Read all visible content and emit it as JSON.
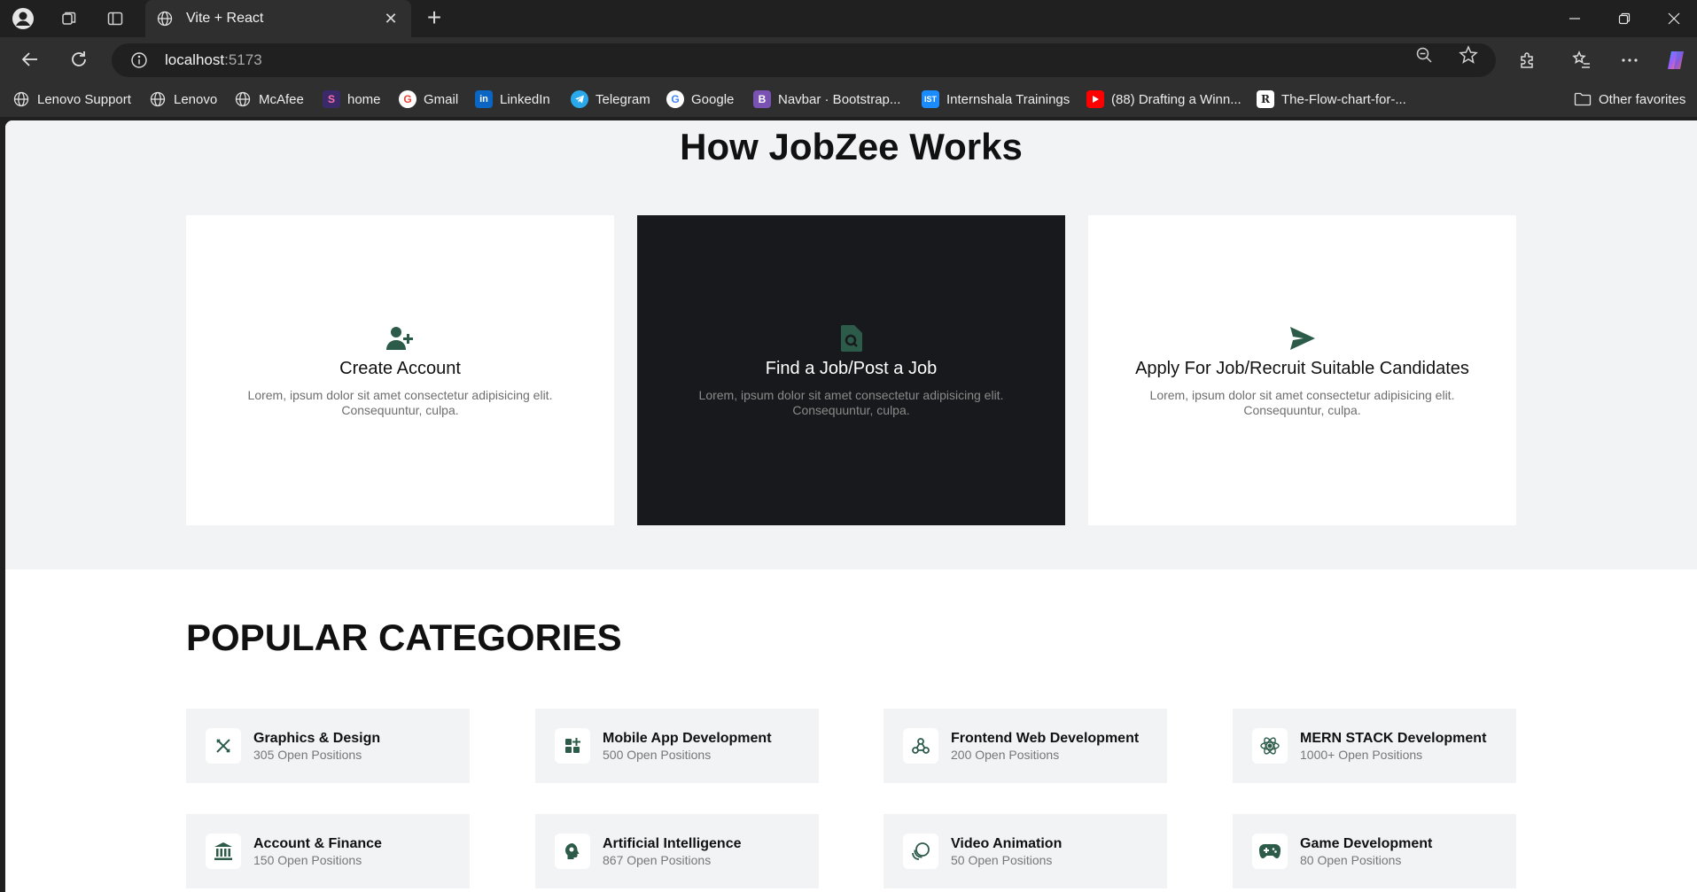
{
  "browser": {
    "tab_title": "Vite + React",
    "url_host": "localhost",
    "url_port": ":5173",
    "bookmarks": [
      {
        "label": "Lenovo Support",
        "icon": "globe-icon"
      },
      {
        "label": "Lenovo",
        "icon": "globe-icon"
      },
      {
        "label": "McAfee",
        "icon": "globe-icon"
      },
      {
        "label": "home",
        "icon": "s-logo-icon"
      },
      {
        "label": "Gmail",
        "icon": "google-icon"
      },
      {
        "label": "LinkedIn",
        "icon": "linkedin-icon"
      },
      {
        "label": "Telegram",
        "icon": "telegram-icon"
      },
      {
        "label": "Google",
        "icon": "google-icon"
      },
      {
        "label": "Navbar · Bootstrap...",
        "icon": "bootstrap-icon"
      },
      {
        "label": "Internshala Trainings",
        "icon": "ist-icon"
      },
      {
        "label": "(88) Drafting a Winn...",
        "icon": "youtube-icon"
      },
      {
        "label": "The-Flow-chart-for-...",
        "icon": "r-logo-icon"
      }
    ],
    "other_favorites": "Other favorites"
  },
  "how_it_works": {
    "title": "How JobZee Works",
    "cards": [
      {
        "title": "Create Account",
        "description": "Lorem, ipsum dolor sit amet consectetur adipisicing elit. Consequuntur, culpa.",
        "icon": "user-plus-icon"
      },
      {
        "title": "Find a Job/Post a Job",
        "description": "Lorem, ipsum dolor sit amet consectetur adipisicing elit. Consequuntur, culpa.",
        "icon": "file-search-icon"
      },
      {
        "title": "Apply For Job/Recruit Suitable Candidates",
        "description": "Lorem, ipsum dolor sit amet consectetur adipisicing elit. Consequuntur, culpa.",
        "icon": "send-icon"
      }
    ]
  },
  "popular_categories": {
    "title": "POPULAR CATEGORIES",
    "items": [
      {
        "name": "Graphics & Design",
        "positions": "305 Open Positions",
        "icon": "design-tools-icon"
      },
      {
        "name": "Mobile App Development",
        "positions": "500 Open Positions",
        "icon": "apps-icon"
      },
      {
        "name": "Frontend Web Development",
        "positions": "200 Open Positions",
        "icon": "webhook-icon"
      },
      {
        "name": "MERN STACK Development",
        "positions": "1000+ Open Positions",
        "icon": "react-icon"
      },
      {
        "name": "Account & Finance",
        "positions": "150 Open Positions",
        "icon": "bank-icon"
      },
      {
        "name": "Artificial Intelligence",
        "positions": "867 Open Positions",
        "icon": "brain-icon"
      },
      {
        "name": "Video Animation",
        "positions": "50 Open Positions",
        "icon": "animation-icon"
      },
      {
        "name": "Game Development",
        "positions": "80 Open Positions",
        "icon": "gamepad-icon"
      }
    ]
  },
  "colors": {
    "accent": "#2d5b4a",
    "section_bg": "#f2f3f5",
    "dark_card": "#18191c"
  }
}
